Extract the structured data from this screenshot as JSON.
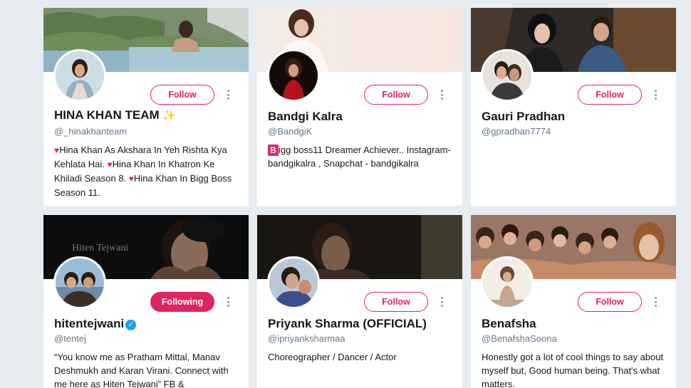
{
  "cards": [
    {
      "name": "HINA KHAN TEAM",
      "name_suffix_icon": "sparkles-icon",
      "handle": "@_hinakhanteam",
      "button": "Follow",
      "bio_parts": [
        "Hina Khan As Akshara In Yeh Rishta Kya Kehlata Hai. ",
        "Hina Khan In Khatron Ke Khiladi Season 8. ",
        "Hina Khan In Bigg Boss Season 11."
      ]
    },
    {
      "name": "Bandgi Kalra",
      "handle": "@BandgiK",
      "button": "Follow",
      "bio_badge": "B",
      "bio": "igg boss11 Dreamer Achiever.. Instagram- bandgikalra , Snapchat - bandgikalra"
    },
    {
      "name": "Gauri Pradhan",
      "handle": "@gpradhan7774",
      "button": "Follow",
      "bio": ""
    },
    {
      "name": "hitentejwani",
      "name_suffix_icon": "verified-badge-icon",
      "handle": "@tentej",
      "button": "Following",
      "banner_text": "Hiten Tejwani",
      "bio": "“You know me as Pratham Mittal, Manav Deshmukh and Karan Virani. Connect with me here as Hiten Tejwani” FB &"
    },
    {
      "name": "Priyank Sharma (OFFICIAL)",
      "handle": "@ipriyanksharmaa",
      "button": "Follow",
      "bio": "Choreographer / Dancer / Actor"
    },
    {
      "name": "Benafsha",
      "handle": "@BenafshaSoona",
      "button": "Follow",
      "bio": "Honestly got a lot of cool things to say about myself but, Good human being. That's what matters."
    }
  ],
  "colors": {
    "page_bg": "#e6ecf0",
    "accent": "#e0245e",
    "verified": "#1da1f2",
    "muted": "#657786"
  }
}
